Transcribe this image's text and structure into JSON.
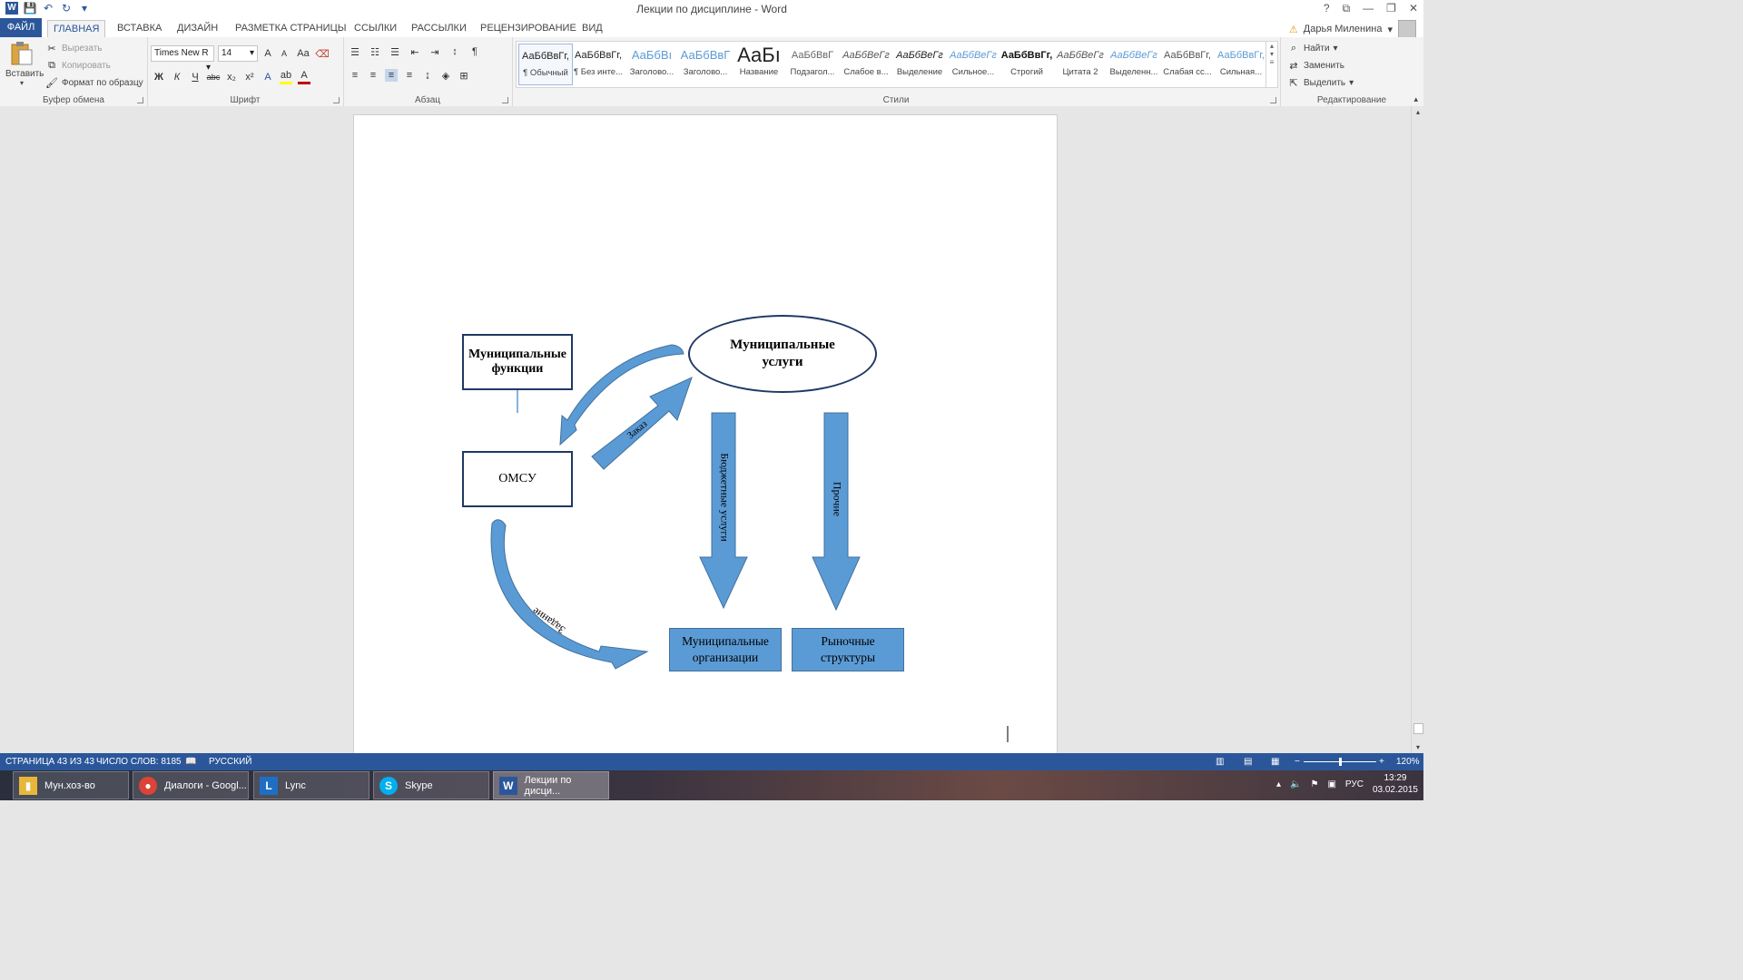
{
  "window": {
    "title": "Лекции по дисциплине - Word",
    "help": "?",
    "controls": [
      "⧉",
      "—",
      "❐",
      "✕"
    ]
  },
  "qat": {
    "save": "💾",
    "undo": "↶",
    "redo": "↻",
    "more": "▾"
  },
  "tabs": [
    "ФАЙЛ",
    "ГЛАВНАЯ",
    "ВСТАВКА",
    "ДИЗАЙН",
    "РАЗМЕТКА СТРАНИЦЫ",
    "ССЫЛКИ",
    "РАССЫЛКИ",
    "РЕЦЕНЗИРОВАНИЕ",
    "ВИД"
  ],
  "user": {
    "name": "Дарья Миленина",
    "warning": "⚠"
  },
  "clipboard": {
    "label": "Буфер обмена",
    "paste": "Вставить",
    "cut": "Вырезать",
    "copy": "Копировать",
    "format_painter": "Формат по образцу"
  },
  "font": {
    "label": "Шрифт",
    "name": "Times New R",
    "size": "14",
    "grow": "A",
    "shrink": "A",
    "case": "Aa",
    "bold": "Ж",
    "italic": "К",
    "underline": "Ч",
    "strike": "abc",
    "sub": "x₂",
    "sup": "x²",
    "color_letter": "A"
  },
  "paragraph": {
    "label": "Абзац",
    "pilcrow": "¶"
  },
  "styles": {
    "label": "Стили",
    "items": [
      {
        "preview": "АаБбВвГг,",
        "name": "¶ Обычный"
      },
      {
        "preview": "АаБбВвГг,",
        "name": "¶ Без инте..."
      },
      {
        "preview": "АаБбВı",
        "name": "Заголово..."
      },
      {
        "preview": "АаБбВвГ",
        "name": "Заголово..."
      },
      {
        "preview": "АаБı",
        "name": "Название"
      },
      {
        "preview": "АаБбВвГ",
        "name": "Подзагол..."
      },
      {
        "preview": "АаБбВеГг",
        "name": "Слабое в..."
      },
      {
        "preview": "АаБбВеГг",
        "name": "Выделение"
      },
      {
        "preview": "АаБбВеГг",
        "name": "Сильное..."
      },
      {
        "preview": "АаБбВвГг,",
        "name": "Строгий"
      },
      {
        "preview": "АаБбВеГг",
        "name": "Цитата 2"
      },
      {
        "preview": "АаБбВеГг",
        "name": "Выделенн..."
      },
      {
        "preview": "АаБбВвГг,",
        "name": "Слабая сс..."
      },
      {
        "preview": "АаБбВвГг,",
        "name": "Сильная..."
      }
    ],
    "colors": [
      "#222222",
      "#222222",
      "#5b9bd5",
      "#5b9bd5",
      "#222222",
      "#666666",
      "#555555",
      "#222222",
      "#5b9bd5",
      "#111111",
      "#555555",
      "#5b9bd5",
      "#555555",
      "#5b9bd5"
    ]
  },
  "editing": {
    "label": "Редактирование",
    "find": "Найти",
    "replace": "Заменить",
    "select": "Выделить"
  },
  "diagram": {
    "functions": "Муниципальные функции",
    "services": "Муниципальные услуги",
    "omsu": "ОМСУ",
    "organizations": "Муниципальные организации",
    "market": "Рыночные структуры",
    "order": "Заказ",
    "budget_services": "Бюджетные услуги",
    "other": "Прочие",
    "task": "Задание",
    "arrow_color": "#5b9bd5"
  },
  "status": {
    "page": "СТРАНИЦА 43 ИЗ 43",
    "words": "ЧИСЛО СЛОВ: 8185",
    "language": "РУССКИЙ",
    "zoom": "120%"
  },
  "taskbar": {
    "items": [
      "Мун.хоз-во",
      "Диалоги - Googl...",
      "Lync",
      "Skype",
      "Лекции по дисци..."
    ],
    "lang": "РУС",
    "time": "13:29",
    "date": "03.02.2015"
  }
}
